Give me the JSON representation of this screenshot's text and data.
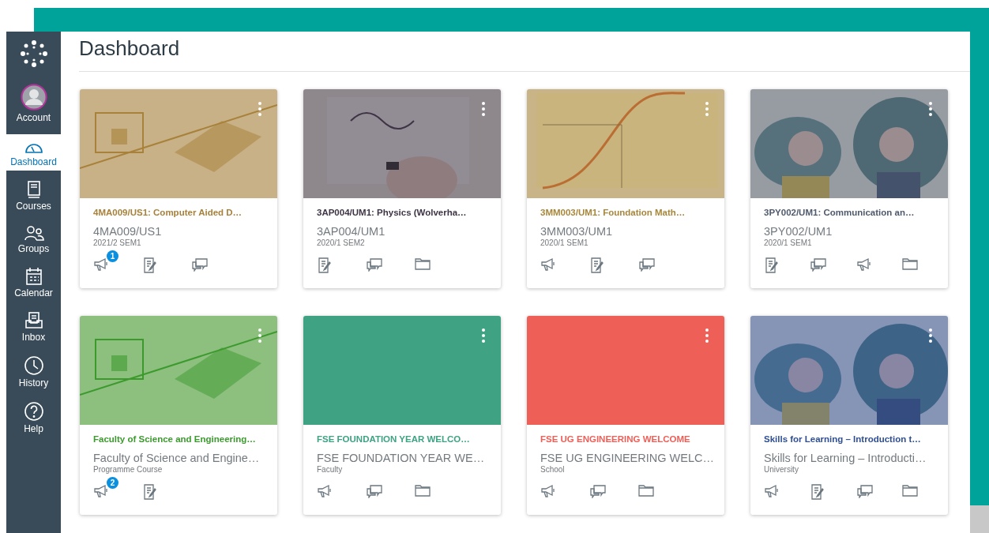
{
  "sidebar": {
    "items": [
      {
        "label": "Account",
        "kind": "account",
        "selected": false
      },
      {
        "label": "Dashboard",
        "kind": "dashboard",
        "selected": true
      },
      {
        "label": "Courses",
        "kind": "courses",
        "selected": false
      },
      {
        "label": "Groups",
        "kind": "groups",
        "selected": false
      },
      {
        "label": "Calendar",
        "kind": "calendar",
        "selected": false
      },
      {
        "label": "Inbox",
        "kind": "inbox",
        "selected": false
      },
      {
        "label": "History",
        "kind": "history",
        "selected": false
      },
      {
        "label": "Help",
        "kind": "help",
        "selected": false
      }
    ]
  },
  "page_title": "Dashboard",
  "cards": [
    {
      "title": "4MA009/US1: Computer Aided D…",
      "code": "4MA009/US1",
      "term": "2021/2 SEM1",
      "color": "#a8813a",
      "image": {
        "kind": "picture"
      },
      "actions": [
        {
          "kind": "announcements",
          "badge": "1"
        },
        {
          "kind": "assignments"
        },
        {
          "kind": "discussions"
        }
      ]
    },
    {
      "title": "3AP004/UM1: Physics (Wolverha…",
      "code": "3AP004/UM1",
      "term": "2020/1 SEM2",
      "color": "#3e3446",
      "image": {
        "kind": "picture"
      },
      "actions": [
        {
          "kind": "assignments"
        },
        {
          "kind": "discussions"
        },
        {
          "kind": "files"
        }
      ]
    },
    {
      "title": "3MM003/UM1: Foundation Math…",
      "code": "3MM003/UM1",
      "term": "2020/1 SEM1",
      "color": "#a8873a",
      "image": {
        "kind": "picture"
      },
      "actions": [
        {
          "kind": "announcements"
        },
        {
          "kind": "assignments"
        },
        {
          "kind": "discussions"
        }
      ]
    },
    {
      "title": "3PY002/UM1: Communication an…",
      "code": "3PY002/UM1",
      "term": "2020/1 SEM1",
      "color": "#4f5a6e",
      "image": {
        "kind": "picture"
      },
      "actions": [
        {
          "kind": "assignments"
        },
        {
          "kind": "discussions"
        },
        {
          "kind": "announcements"
        },
        {
          "kind": "files"
        }
      ]
    },
    {
      "title": "Faculty of Science and Engineering…",
      "code": "Faculty of Science and Engine…",
      "term": "Programme Course",
      "color": "#3c9a2e",
      "image": {
        "kind": "picture"
      },
      "actions": [
        {
          "kind": "announcements",
          "badge": "2"
        },
        {
          "kind": "assignments"
        }
      ]
    },
    {
      "title": "FSE FOUNDATION YEAR WELCO…",
      "code": "FSE FOUNDATION YEAR WE…",
      "term": "Faculty",
      "color": "#3ea283",
      "actions": [
        {
          "kind": "announcements"
        },
        {
          "kind": "discussions"
        },
        {
          "kind": "files"
        }
      ]
    },
    {
      "title": "FSE UG ENGINEERING WELCOME",
      "code": "FSE UG ENGINEERING WELC…",
      "term": "School",
      "color": "#ee5f58",
      "actions": [
        {
          "kind": "announcements"
        },
        {
          "kind": "discussions"
        },
        {
          "kind": "files"
        }
      ]
    },
    {
      "title": "Skills for Learning – Introduction t…",
      "code": "Skills for Learning – Introducti…",
      "term": "University",
      "color": "#2f4f92",
      "image": {
        "kind": "picture"
      },
      "actions": [
        {
          "kind": "announcements"
        },
        {
          "kind": "assignments"
        },
        {
          "kind": "discussions"
        },
        {
          "kind": "files"
        }
      ]
    }
  ]
}
